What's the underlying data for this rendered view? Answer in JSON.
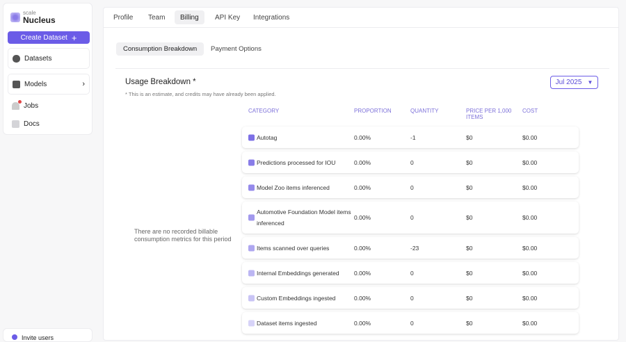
{
  "sidebar": {
    "brand_small": "scale",
    "brand": "Nucleus",
    "create_label": "Create Dataset",
    "create_icon": "+",
    "datasets": "Datasets",
    "models": "Models",
    "jobs": "Jobs",
    "docs": "Docs",
    "invite": "Invite users"
  },
  "tabs": [
    "Profile",
    "Team",
    "Billing",
    "API Key",
    "Integrations"
  ],
  "subtabs": [
    "Consumption Breakdown",
    "Payment Options"
  ],
  "usage": {
    "title": "Usage Breakdown *",
    "note": "* This is an estimate, and credits may have already been applied.",
    "month": "Jul 2025",
    "empty": "There are no recorded billable consumption metrics for this period"
  },
  "columns": [
    "CATEGORY",
    "PROPORTION",
    "QUANTITY",
    "PRICE PER 1,000 ITEMS",
    "COST"
  ],
  "rows": [
    {
      "category": "Autotag",
      "proportion": "0.00%",
      "quantity": "-1",
      "price": "$0",
      "cost": "$0.00",
      "color": "#7d70e6"
    },
    {
      "category": "Predictions processed for IOU",
      "proportion": "0.00%",
      "quantity": "0",
      "price": "$0",
      "cost": "$0.00",
      "color": "#887ce8"
    },
    {
      "category": "Model Zoo items inferenced",
      "proportion": "0.00%",
      "quantity": "0",
      "price": "$0",
      "cost": "$0.00",
      "color": "#958aeb"
    },
    {
      "category": "Automotive Foundation Model items inferenced",
      "proportion": "0.00%",
      "quantity": "0",
      "price": "$0",
      "cost": "$0.00",
      "color": "#a299ed"
    },
    {
      "category": "Items scanned over queries",
      "proportion": "0.00%",
      "quantity": "-23",
      "price": "$0",
      "cost": "$0.00",
      "color": "#afa7f0"
    },
    {
      "category": "Internal Embeddings generated",
      "proportion": "0.00%",
      "quantity": "0",
      "price": "$0",
      "cost": "$0.00",
      "color": "#bcb6f3"
    },
    {
      "category": "Custom Embeddings ingested",
      "proportion": "0.00%",
      "quantity": "0",
      "price": "$0",
      "cost": "$0.00",
      "color": "#c9c4f5"
    },
    {
      "category": "Dataset items ingested",
      "proportion": "0.00%",
      "quantity": "0",
      "price": "$0",
      "cost": "$0.00",
      "color": "#d7d3f8"
    }
  ]
}
